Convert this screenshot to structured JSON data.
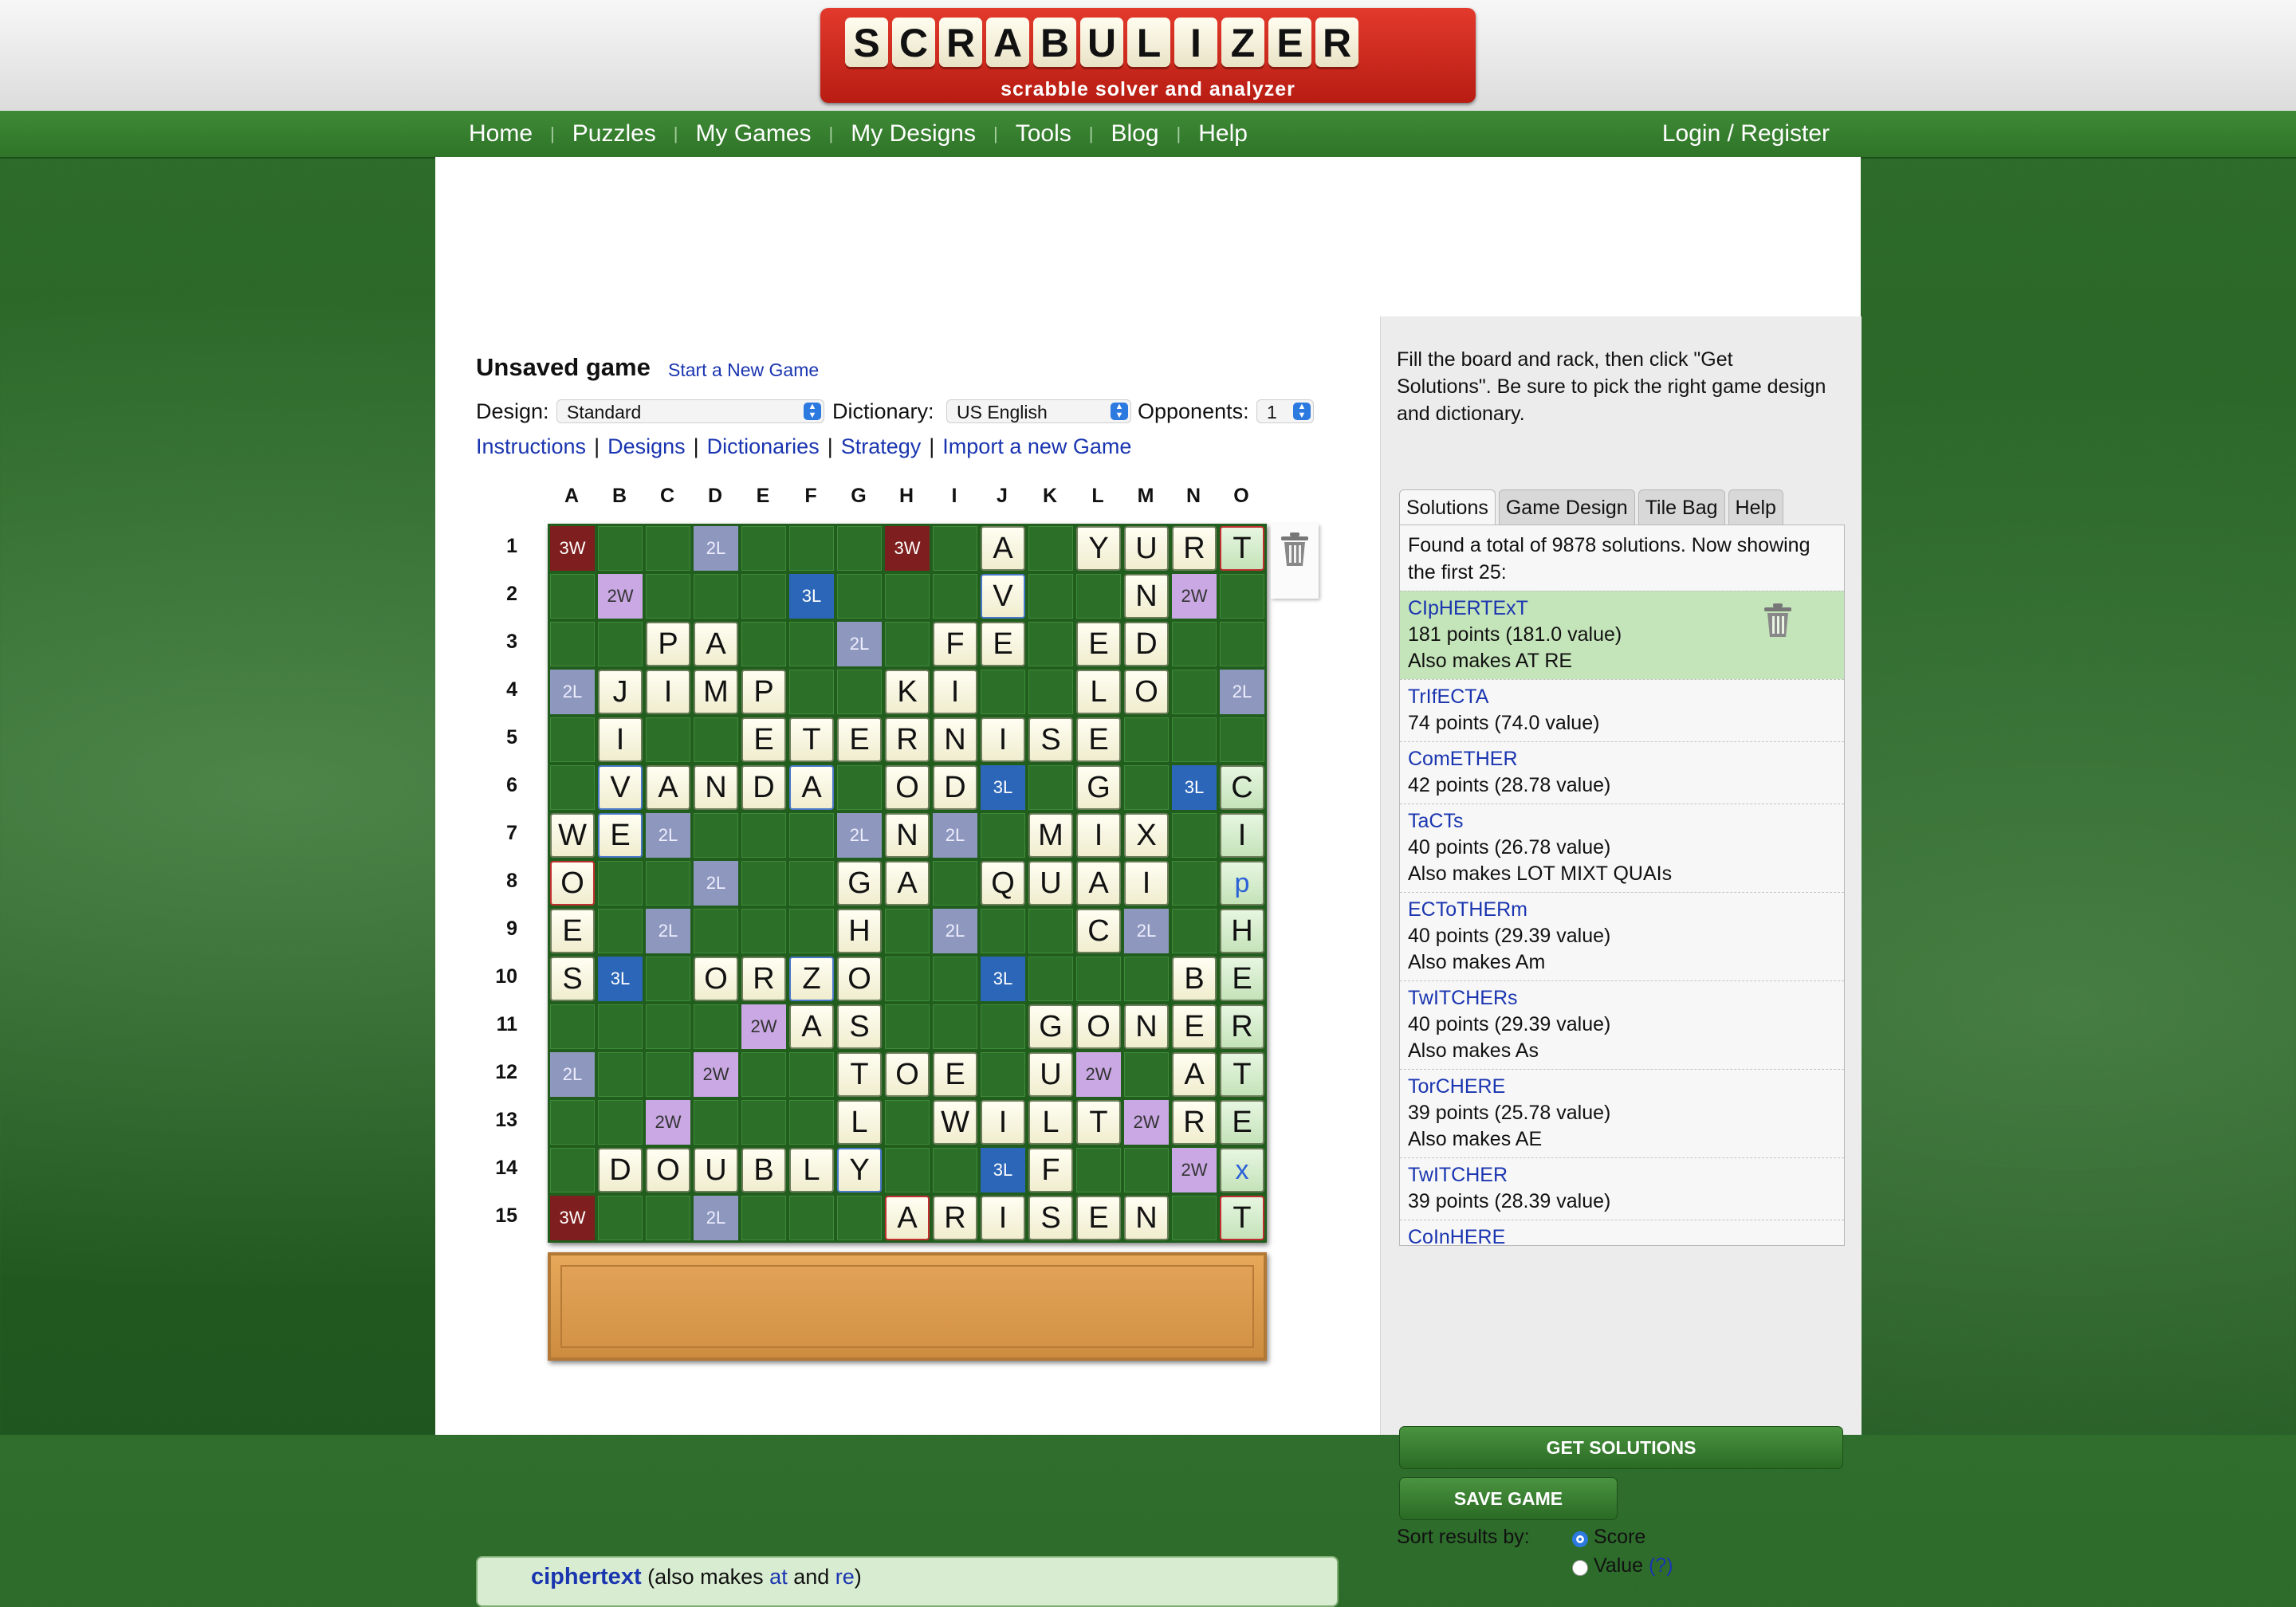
{
  "header": {
    "logo_letters": [
      "S",
      "C",
      "R",
      "A",
      "B",
      "U",
      "L",
      "I",
      "Z",
      "E",
      "R"
    ],
    "logo_tagline": "scrabble solver and analyzer"
  },
  "nav": {
    "items": [
      "Home",
      "Puzzles",
      "My Games",
      "My Designs",
      "Tools",
      "Blog",
      "Help"
    ],
    "login": "Login / Register"
  },
  "game": {
    "title": "Unsaved game",
    "new_game_link": "Start a New Game",
    "design_label": "Design:",
    "design_value": "Standard",
    "dictionary_label": "Dictionary:",
    "dictionary_value": "US English",
    "opponents_label": "Opponents:",
    "opponents_value": "1",
    "links": [
      "Instructions",
      "Designs",
      "Dictionaries",
      "Strategy",
      "Import a new Game"
    ]
  },
  "board": {
    "columns": [
      "A",
      "B",
      "C",
      "D",
      "E",
      "F",
      "G",
      "H",
      "I",
      "J",
      "K",
      "L",
      "M",
      "N",
      "O"
    ],
    "rows": [
      "1",
      "2",
      "3",
      "4",
      "5",
      "6",
      "7",
      "8",
      "9",
      "10",
      "11",
      "12",
      "13",
      "14",
      "15"
    ],
    "premium_labels": {
      "tw": "3W",
      "dw": "2W",
      "tl": "3L",
      "dl": "2L"
    },
    "premium": [
      "tw....dl...tw.......",
      ".dw...tl.......dw.",
      "..........dl.........",
      "dl..................dl",
      "...............",
      "..........tl....tl..",
      "..dl.......dl.dl......",
      "...dl...........",
      "..dl.......dl...dl..",
      ".tl.......tl.....",
      "....dw..........",
      "dl..dw.......dw...",
      "..dw.......dw....dw..",
      ".........tl...dw.",
      "tw..dl..........."
    ],
    "grid": [
      "tw.._.dl..._tw_.A_.YURT",
      "_dw.._.tl_.._V_..N dw_",
      "..PA._dl.FE.ED..",
      "dl JIMP..KI..LO.dl",
      ".I..ETERNISE....",
      ".VANDA.OD tl .G.tl C",
      "WE dl...dl N dl.MIX.I",
      "O..dl..GA.QUAI.p",
      "E.dl...H.dl..C dl.H",
      "S tl.ORZO..tl...BE",
      "....dw AS..GONER",
      "dl..dw..TOE.U dw.AT",
      "..dw....L.WILT dw RE",
      ".DOUBLY..tl F..dw x",
      "tw..dl...ARISEN.T"
    ],
    "tiles": {
      "1": {
        "J": "A",
        "L": "Y",
        "M": "U",
        "N": "R",
        "O": "T"
      },
      "2": {
        "J": "V",
        "M": "N"
      },
      "3": {
        "C": "P",
        "D": "A",
        "I": "F",
        "J": "E",
        "L": "E",
        "M": "D"
      },
      "4": {
        "B": "J",
        "C": "I",
        "D": "M",
        "E": "P",
        "H": "K",
        "I": "I",
        "L": "L",
        "M": "O"
      },
      "5": {
        "B": "I",
        "E": "E",
        "F": "T",
        "G": "E",
        "H": "R",
        "I": "N",
        "J": "I",
        "K": "S",
        "L": "E"
      },
      "6": {
        "B": "V",
        "C": "A",
        "D": "N",
        "E": "D",
        "F": "A",
        "H": "O",
        "I": "D",
        "L": "G",
        "O": "C"
      },
      "7": {
        "A": "W",
        "B": "E",
        "H": "N",
        "K": "M",
        "L": "I",
        "M": "X",
        "O": "I"
      },
      "8": {
        "A": "O",
        "G": "G",
        "H": "A",
        "J": "Q",
        "K": "U",
        "L": "A",
        "M": "I",
        "O": "p"
      },
      "9": {
        "A": "E",
        "G": "H",
        "L": "C",
        "O": "H"
      },
      "10": {
        "A": "S",
        "D": "O",
        "E": "R",
        "F": "Z",
        "G": "O",
        "N": "B",
        "O": "E"
      },
      "11": {
        "F": "A",
        "G": "S",
        "K": "G",
        "L": "O",
        "M": "N",
        "N": "E",
        "O": "R"
      },
      "12": {
        "G": "T",
        "H": "O",
        "I": "E",
        "K": "U",
        "N": "A",
        "O": "T"
      },
      "13": {
        "G": "L",
        "I": "W",
        "J": "I",
        "K": "L",
        "L": "T",
        "N": "R",
        "O": "E"
      },
      "14": {
        "B": "D",
        "C": "O",
        "D": "U",
        "E": "B",
        "F": "L",
        "G": "Y",
        "K": "F",
        "O": "x"
      },
      "15": {
        "H": "A",
        "I": "R",
        "J": "I",
        "K": "S",
        "L": "E",
        "M": "N",
        "O": "T"
      }
    },
    "premiums": {
      "1": {
        "A": "tw",
        "D": "dl",
        "H": "tw"
      },
      "2": {
        "B": "dw",
        "F": "tl",
        "N": "dw"
      },
      "3": {
        "G": "dl"
      },
      "4": {
        "A": "dl",
        "O": "dl"
      },
      "6": {
        "J": "tl",
        "N": "tl"
      },
      "7": {
        "C": "dl",
        "G": "dl",
        "I": "dl"
      },
      "8": {
        "D": "dl"
      },
      "9": {
        "C": "dl",
        "I": "dl",
        "M": "dl"
      },
      "10": {
        "B": "tl",
        "J": "tl"
      },
      "11": {
        "E": "dw"
      },
      "12": {
        "A": "dl",
        "D": "dw",
        "L": "dw"
      },
      "13": {
        "C": "dw",
        "M": "dw"
      },
      "14": {
        "J": "tl",
        "N": "dw"
      },
      "15": {
        "A": "tw",
        "D": "dl"
      }
    }
  },
  "result": {
    "word": "ciphertext",
    "pre": " (also makes ",
    "w1": "at",
    "mid": " and ",
    "w2": "re",
    "post": ")"
  },
  "right": {
    "intro": "Fill the board and rack, then click \"Get Solutions\". Be sure to pick the right game design and dictionary.",
    "tabs": [
      "Solutions",
      "Game Design",
      "Tile Bag",
      "Help"
    ],
    "summary": "Found a total of 9878 solutions. Now showing the first 25:",
    "solutions": [
      {
        "word": "CIpHERTExT",
        "points": "181 points (181.0 value)",
        "also": "Also makes AT RE"
      },
      {
        "word": "TrIfECTA",
        "points": "74 points (74.0 value)",
        "also": ""
      },
      {
        "word": "ComETHER",
        "points": "42 points (28.78 value)",
        "also": ""
      },
      {
        "word": "TaCTs",
        "points": "40 points (26.78 value)",
        "also": "Also makes LOT MIXT QUAIs"
      },
      {
        "word": "ECToTHERm",
        "points": "40 points (29.39 value)",
        "also": "Also makes Am"
      },
      {
        "word": "TwITCHERs",
        "points": "40 points (29.39 value)",
        "also": "Also makes As"
      },
      {
        "word": "TorCHERE",
        "points": "39 points (25.78 value)",
        "also": "Also makes AE"
      },
      {
        "word": "TwITCHER",
        "points": "39 points (28.39 value)",
        "also": ""
      },
      {
        "word": "CoInHERE",
        "points": "",
        "also": ""
      }
    ],
    "get_solutions": "GET SOLUTIONS",
    "save_game": "SAVE GAME",
    "sort_label": "Sort results by:",
    "sort_score": "Score",
    "sort_value": "Value",
    "sort_value_help": "(?)"
  },
  "colors": {
    "green_nav": "#3e8a36",
    "logo_red": "#d42b1f",
    "link_blue": "#1a35b0",
    "selected_row": "#c4e4b9"
  }
}
